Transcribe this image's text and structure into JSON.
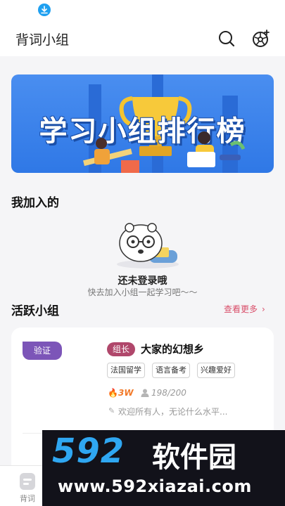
{
  "header": {
    "title": "背词小组"
  },
  "banner": {
    "title": "学习小组排行榜"
  },
  "joined": {
    "section_title": "我加入的",
    "empty_title": "还未登录哦",
    "empty_subtitle": "快去加入小组一起学习吧～～"
  },
  "active": {
    "section_title": "活跃小组",
    "more_label": "查看更多"
  },
  "group_card": {
    "verify_badge": "验证",
    "leader_badge": "组长",
    "name": "大家的幻想乡",
    "tags": [
      "法国留学",
      "语言备考",
      "兴趣爱好"
    ],
    "heat": "3W",
    "members": "198/200",
    "motto": "欢迎所有人，无论什么水平..."
  },
  "tabbar": {
    "items": [
      {
        "label": "背词",
        "icon": "book-icon"
      }
    ]
  },
  "watermark": {
    "logo": "592",
    "brand": "软件园",
    "url": "www.592xiazai.com"
  },
  "colors": {
    "accent": "#d94f6a",
    "banner_blue": "#3a82ea",
    "verify_purple": "#7c55b8",
    "leader_pink": "#b0476b",
    "heat_orange": "#f27a2a"
  }
}
